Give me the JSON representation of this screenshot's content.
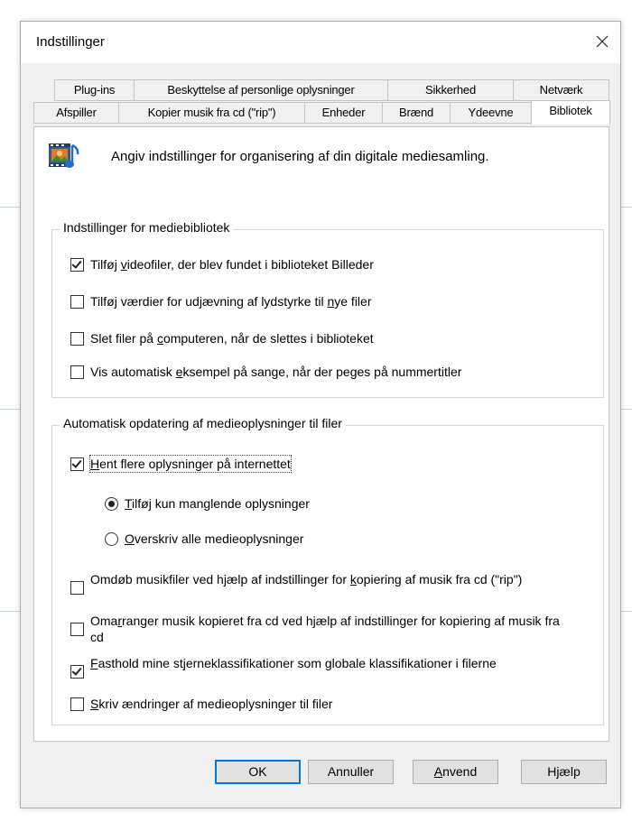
{
  "window": {
    "title": "Indstillinger"
  },
  "tabs_back": [
    {
      "label": "Plug-ins"
    },
    {
      "label": "Beskyttelse af personlige oplysninger"
    },
    {
      "label": "Sikkerhed"
    },
    {
      "label": "Netværk"
    }
  ],
  "tabs_front": [
    {
      "label": "Afspiller"
    },
    {
      "label": "Kopier musik fra cd (\"rip\")"
    },
    {
      "label": "Enheder"
    },
    {
      "label": "Brænd"
    },
    {
      "label": "Ydeevne"
    },
    {
      "label": "Bibliotek",
      "active": true
    }
  ],
  "header": {
    "icon": "media-library-icon",
    "text": "Angiv indstillinger for organisering af din digitale mediesamling."
  },
  "group_library": {
    "title": "Indstillinger for mediebibliotek",
    "options": [
      {
        "label": "Tilføj videofiler, der blev fundet i biblioteket Billeder",
        "checked": true
      },
      {
        "label": "Tilføj værdier for udjævning af lydstyrke til nye filer",
        "checked": false
      },
      {
        "label": "Slet filer på computeren, når de slettes i biblioteket",
        "checked": false
      },
      {
        "label": "Vis automatisk eksempel på sange, når der peges på nummertitler",
        "checked": false
      }
    ]
  },
  "group_update": {
    "title": "Automatisk opdatering af medieoplysninger til filer",
    "fetch": {
      "label": "Hent flere oplysninger på internettet",
      "checked": true
    },
    "radios": [
      {
        "label": "Tilføj kun manglende oplysninger",
        "selected": true
      },
      {
        "label": "Overskriv alle medieoplysninger",
        "selected": false
      }
    ],
    "options": [
      {
        "label": "Omdøb musikfiler ved hjælp af indstillinger for kopiering af musik fra cd (\"rip\")",
        "checked": false
      },
      {
        "label": "Omarranger musik kopieret fra cd ved hjælp af indstillinger for kopiering af musik fra cd",
        "checked": false
      },
      {
        "label": "Fasthold mine stjerneklassifikationer som globale klassifikationer i filerne",
        "checked": true
      },
      {
        "label": "Skriv ændringer af medieoplysninger til filer",
        "checked": false
      }
    ]
  },
  "buttons": {
    "ok": "OK",
    "cancel": "Annuller",
    "apply": "Anvend",
    "help": "Hjælp"
  },
  "colors": {
    "accent": "#0078d7",
    "dialog_bg": "#f0f0f0",
    "panel_bg": "#ffffff"
  }
}
